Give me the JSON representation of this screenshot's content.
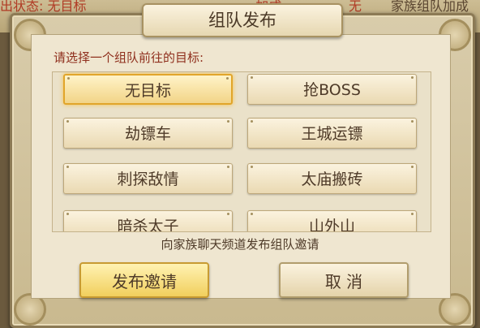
{
  "background": {
    "left_text": "出状态: 无目标",
    "mid_text": "...加成",
    "mid_value": "无",
    "right_text": "家族组队加成"
  },
  "dialog": {
    "title": "组队发布",
    "prompt": "请选择一个组队前往的目标:",
    "options": [
      {
        "label": "无目标",
        "selected": true
      },
      {
        "label": "抢BOSS",
        "selected": false
      },
      {
        "label": "劫镖车",
        "selected": false
      },
      {
        "label": "王城运镖",
        "selected": false
      },
      {
        "label": "刺探敌情",
        "selected": false
      },
      {
        "label": "太庙搬砖",
        "selected": false
      },
      {
        "label": "暗杀太子",
        "selected": false
      },
      {
        "label": "山外山",
        "selected": false
      }
    ],
    "hint": "向家族聊天频道发布组队邀请",
    "publish_label": "发布邀请",
    "cancel_label": "取 消"
  }
}
